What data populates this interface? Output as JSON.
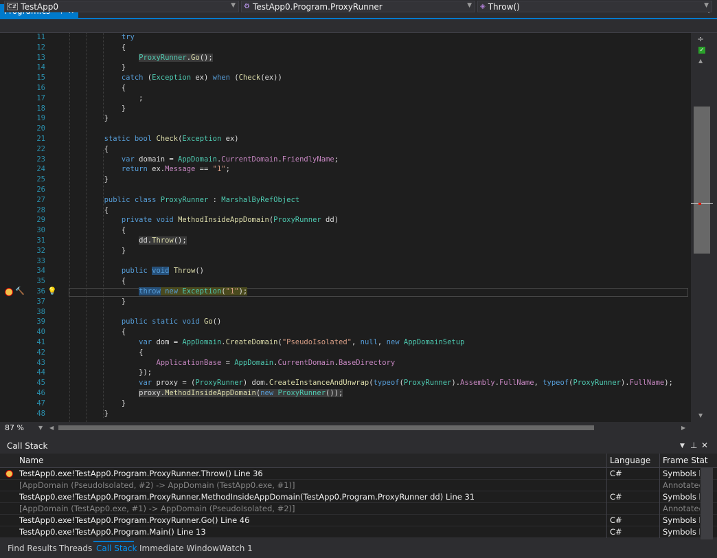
{
  "tab": {
    "title": "Program.cs",
    "pin": "⊣",
    "close": "✕"
  },
  "nav": {
    "project": "TestApp0",
    "project_icon": "C#",
    "type": "TestApp0.Program.ProxyRunner",
    "member": "Throw()"
  },
  "editor": {
    "zoom": "87 %",
    "lines": [
      {
        "n": "11"
      },
      {
        "n": "12"
      },
      {
        "n": "13"
      },
      {
        "n": "14"
      },
      {
        "n": "15"
      },
      {
        "n": "16"
      },
      {
        "n": "17"
      },
      {
        "n": "18"
      },
      {
        "n": "19"
      },
      {
        "n": "20"
      },
      {
        "n": "21"
      },
      {
        "n": "22"
      },
      {
        "n": "23"
      },
      {
        "n": "24"
      },
      {
        "n": "25"
      },
      {
        "n": "26"
      },
      {
        "n": "27"
      },
      {
        "n": "28"
      },
      {
        "n": "29"
      },
      {
        "n": "30"
      },
      {
        "n": "31"
      },
      {
        "n": "32"
      },
      {
        "n": "33"
      },
      {
        "n": "34"
      },
      {
        "n": "35"
      },
      {
        "n": "36"
      },
      {
        "n": "37"
      },
      {
        "n": "38"
      },
      {
        "n": "39"
      },
      {
        "n": "40"
      },
      {
        "n": "41"
      },
      {
        "n": "42"
      },
      {
        "n": "43"
      },
      {
        "n": "44"
      },
      {
        "n": "45"
      },
      {
        "n": "46"
      },
      {
        "n": "47"
      },
      {
        "n": "48"
      }
    ]
  },
  "callstack": {
    "title": "Call Stack",
    "columns": {
      "name": "Name",
      "language": "Language",
      "status": "Frame Stat"
    },
    "rows": [
      {
        "name": "TestApp0.exe!TestApp0.Program.ProxyRunner.Throw() Line 36",
        "lang": "C#",
        "status": "Symbols lo",
        "current": true
      },
      {
        "name": "[AppDomain (PseudoIsolated, #2) -> AppDomain (TestApp0.exe, #1)]",
        "lang": "",
        "status": "Annotated",
        "annotated": true
      },
      {
        "name": "TestApp0.exe!TestApp0.Program.ProxyRunner.MethodInsideAppDomain(TestApp0.Program.ProxyRunner dd) Line 31",
        "lang": "C#",
        "status": "Symbols lo"
      },
      {
        "name": "[AppDomain (TestApp0.exe, #1) -> AppDomain (PseudoIsolated, #2)]",
        "lang": "",
        "status": "Annotated",
        "annotated": true
      },
      {
        "name": "TestApp0.exe!TestApp0.Program.ProxyRunner.Go() Line 46",
        "lang": "C#",
        "status": "Symbols lo"
      },
      {
        "name": "TestApp0.exe!TestApp0.Program.Main() Line 13",
        "lang": "C#",
        "status": "Symbols lo"
      }
    ]
  },
  "bottom_tabs": [
    "Find Results",
    "Threads",
    "Call Stack",
    "Immediate Window",
    "Watch 1"
  ],
  "colors": {
    "accent": "#007acc",
    "editor_bg": "#1e1e1e",
    "chrome_bg": "#2d2d30"
  }
}
